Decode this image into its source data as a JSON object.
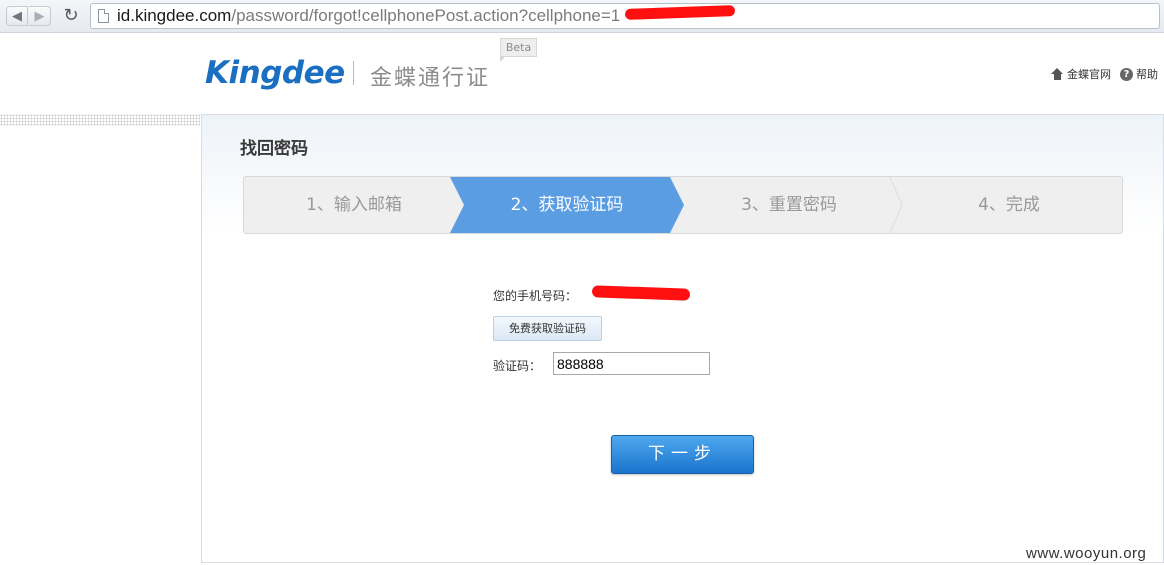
{
  "browser": {
    "url_host": "id.kingdee.com",
    "url_path": "/password/forgot!cellphonePost.action?cellphone=1"
  },
  "header": {
    "logo_text": "Kingdee",
    "product_name": "金蝶通行证",
    "beta_badge": "Beta",
    "official_site_link": "金蝶官网",
    "help_link": "帮助",
    "help_glyph": "?"
  },
  "page": {
    "title": "找回密码",
    "steps": [
      {
        "label": "1、输入邮箱"
      },
      {
        "label": "2、获取验证码"
      },
      {
        "label": "3、重置密码"
      },
      {
        "label": "4、完成"
      }
    ],
    "active_step": 2
  },
  "form": {
    "phone_label": "您的手机号码：",
    "send_code_button": "免费获取验证码",
    "code_label": "验证码：",
    "code_value": "888888",
    "next_button": "下一步"
  },
  "watermark": "www.wooyun.org",
  "colors": {
    "brand": "#1a6fc1",
    "active_step": "#5b9de2",
    "primary_button": "#1a74cc",
    "redaction": "#ff1010"
  },
  "icons": [
    "back-icon",
    "forward-icon",
    "reload-icon",
    "page-icon",
    "home-icon",
    "help-icon"
  ]
}
